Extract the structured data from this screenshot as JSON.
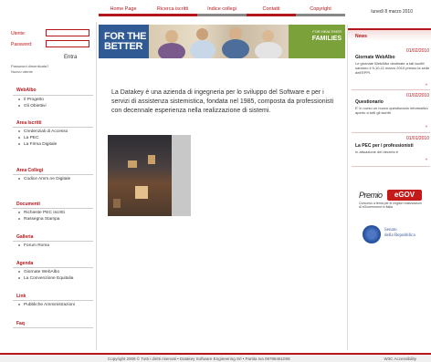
{
  "nav": {
    "tabs": [
      "Home Page",
      "Ricerca iscritti",
      "Indice collegi",
      "Contatti",
      "Copyright"
    ]
  },
  "date": "lunedì 8 marzo 2010",
  "login": {
    "user_label": "Utente:",
    "password_label": "Password:",
    "submit": "Entra",
    "forgot": "Password dimenticata?",
    "new_user": "Nuovo utente"
  },
  "sidebar": {
    "sections": [
      {
        "title": "WebAlbo",
        "items": [
          "Il Progetto",
          "Gli Obiettivi"
        ]
      },
      {
        "title": "Area Iscritti",
        "items": [
          "Credenziali di Accesso",
          "La PEC",
          "La Firma Digitale"
        ]
      },
      {
        "title": "Area Collegi",
        "items": [
          "Codice Amm.ne Digitale"
        ]
      },
      {
        "title": "Documenti",
        "items": [
          "Richieste PEC Iscritti",
          "Rassegna Stampa"
        ]
      },
      {
        "title": "Galleria",
        "items": [
          "Forum Roma"
        ]
      },
      {
        "title": "Agenda",
        "items": [
          "Giornate WebAlbo",
          "La Convenzione Equitalia"
        ]
      },
      {
        "title": "Link",
        "items": [
          "Pubbliche Amministrazioni"
        ]
      },
      {
        "title": "Faq",
        "items": []
      }
    ]
  },
  "banner": {
    "left": "FOR THE BETTER",
    "right_small": "FOR HEALTHIER",
    "right_big": "FAMILIES"
  },
  "main": {
    "intro": "La Datakey è una azienda di ingegneria per lo sviluppo del Software e per i servizi di assistenza sistemistica, fondata nel 1985, composta da professionisti con decennale esperienza nella realizzazione di sistemi."
  },
  "news": {
    "heading": "News",
    "items": [
      {
        "date": "01/02/2010",
        "title": "Giornate WebAlbo",
        "text": "Le giornate WebAlbo destinate a tali iscritti saranno il 9-10-11 marzo 2010 presso la sede dell'EPPI.",
        "more": "»"
      },
      {
        "date": "01/02/2010",
        "title": "Questionario",
        "text": "E' in corso un nuovo questionario informativo aperto a tutti gli iscritti",
        "more": "»"
      },
      {
        "date": "01/01/2010",
        "title": "La PEC per i professionisti",
        "text": "In attuazione del decreto è",
        "more": "»"
      }
    ]
  },
  "premio": {
    "word": "Premio",
    "logo": "eGOV",
    "sub": "Concorso a tema per le migliori realizzazioni di eGovernment in Italia"
  },
  "senato": {
    "line1": "Senato",
    "line2": "della Repubblica"
  },
  "footer": {
    "text": "Copyright 2009 © Tutti i diritti riservati • Datakey Software Engineering Srl • Partita Iva 09798461008",
    "right": "W3C Accessibility"
  }
}
